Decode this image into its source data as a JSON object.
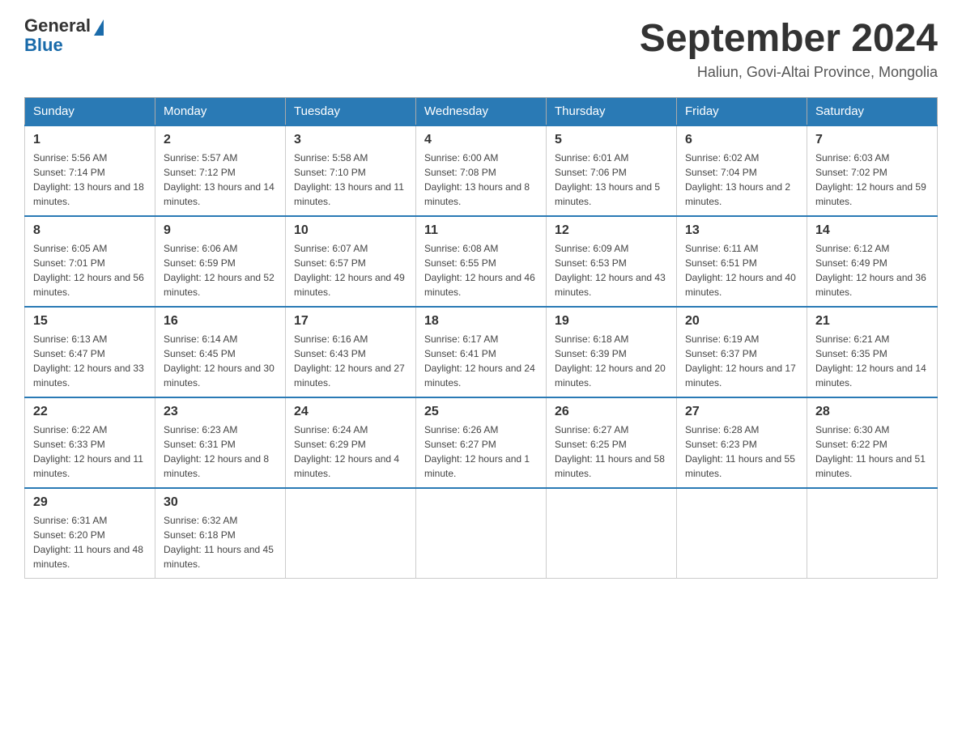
{
  "logo": {
    "general": "General",
    "blue": "Blue"
  },
  "title": "September 2024",
  "location": "Haliun, Govi-Altai Province, Mongolia",
  "days_of_week": [
    "Sunday",
    "Monday",
    "Tuesday",
    "Wednesday",
    "Thursday",
    "Friday",
    "Saturday"
  ],
  "weeks": [
    [
      {
        "day": "1",
        "sunrise": "5:56 AM",
        "sunset": "7:14 PM",
        "daylight": "13 hours and 18 minutes."
      },
      {
        "day": "2",
        "sunrise": "5:57 AM",
        "sunset": "7:12 PM",
        "daylight": "13 hours and 14 minutes."
      },
      {
        "day": "3",
        "sunrise": "5:58 AM",
        "sunset": "7:10 PM",
        "daylight": "13 hours and 11 minutes."
      },
      {
        "day": "4",
        "sunrise": "6:00 AM",
        "sunset": "7:08 PM",
        "daylight": "13 hours and 8 minutes."
      },
      {
        "day": "5",
        "sunrise": "6:01 AM",
        "sunset": "7:06 PM",
        "daylight": "13 hours and 5 minutes."
      },
      {
        "day": "6",
        "sunrise": "6:02 AM",
        "sunset": "7:04 PM",
        "daylight": "13 hours and 2 minutes."
      },
      {
        "day": "7",
        "sunrise": "6:03 AM",
        "sunset": "7:02 PM",
        "daylight": "12 hours and 59 minutes."
      }
    ],
    [
      {
        "day": "8",
        "sunrise": "6:05 AM",
        "sunset": "7:01 PM",
        "daylight": "12 hours and 56 minutes."
      },
      {
        "day": "9",
        "sunrise": "6:06 AM",
        "sunset": "6:59 PM",
        "daylight": "12 hours and 52 minutes."
      },
      {
        "day": "10",
        "sunrise": "6:07 AM",
        "sunset": "6:57 PM",
        "daylight": "12 hours and 49 minutes."
      },
      {
        "day": "11",
        "sunrise": "6:08 AM",
        "sunset": "6:55 PM",
        "daylight": "12 hours and 46 minutes."
      },
      {
        "day": "12",
        "sunrise": "6:09 AM",
        "sunset": "6:53 PM",
        "daylight": "12 hours and 43 minutes."
      },
      {
        "day": "13",
        "sunrise": "6:11 AM",
        "sunset": "6:51 PM",
        "daylight": "12 hours and 40 minutes."
      },
      {
        "day": "14",
        "sunrise": "6:12 AM",
        "sunset": "6:49 PM",
        "daylight": "12 hours and 36 minutes."
      }
    ],
    [
      {
        "day": "15",
        "sunrise": "6:13 AM",
        "sunset": "6:47 PM",
        "daylight": "12 hours and 33 minutes."
      },
      {
        "day": "16",
        "sunrise": "6:14 AM",
        "sunset": "6:45 PM",
        "daylight": "12 hours and 30 minutes."
      },
      {
        "day": "17",
        "sunrise": "6:16 AM",
        "sunset": "6:43 PM",
        "daylight": "12 hours and 27 minutes."
      },
      {
        "day": "18",
        "sunrise": "6:17 AM",
        "sunset": "6:41 PM",
        "daylight": "12 hours and 24 minutes."
      },
      {
        "day": "19",
        "sunrise": "6:18 AM",
        "sunset": "6:39 PM",
        "daylight": "12 hours and 20 minutes."
      },
      {
        "day": "20",
        "sunrise": "6:19 AM",
        "sunset": "6:37 PM",
        "daylight": "12 hours and 17 minutes."
      },
      {
        "day": "21",
        "sunrise": "6:21 AM",
        "sunset": "6:35 PM",
        "daylight": "12 hours and 14 minutes."
      }
    ],
    [
      {
        "day": "22",
        "sunrise": "6:22 AM",
        "sunset": "6:33 PM",
        "daylight": "12 hours and 11 minutes."
      },
      {
        "day": "23",
        "sunrise": "6:23 AM",
        "sunset": "6:31 PM",
        "daylight": "12 hours and 8 minutes."
      },
      {
        "day": "24",
        "sunrise": "6:24 AM",
        "sunset": "6:29 PM",
        "daylight": "12 hours and 4 minutes."
      },
      {
        "day": "25",
        "sunrise": "6:26 AM",
        "sunset": "6:27 PM",
        "daylight": "12 hours and 1 minute."
      },
      {
        "day": "26",
        "sunrise": "6:27 AM",
        "sunset": "6:25 PM",
        "daylight": "11 hours and 58 minutes."
      },
      {
        "day": "27",
        "sunrise": "6:28 AM",
        "sunset": "6:23 PM",
        "daylight": "11 hours and 55 minutes."
      },
      {
        "day": "28",
        "sunrise": "6:30 AM",
        "sunset": "6:22 PM",
        "daylight": "11 hours and 51 minutes."
      }
    ],
    [
      {
        "day": "29",
        "sunrise": "6:31 AM",
        "sunset": "6:20 PM",
        "daylight": "11 hours and 48 minutes."
      },
      {
        "day": "30",
        "sunrise": "6:32 AM",
        "sunset": "6:18 PM",
        "daylight": "11 hours and 45 minutes."
      },
      null,
      null,
      null,
      null,
      null
    ]
  ]
}
